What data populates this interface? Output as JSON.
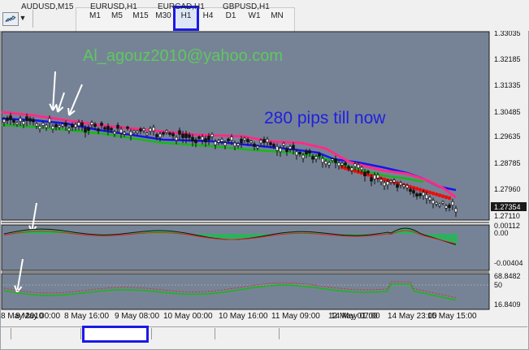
{
  "toolbar": {
    "chart_icon": "chart-line-icon",
    "dropdown_icon": "chevron-down-icon",
    "timeframes": [
      "M1",
      "M5",
      "M15",
      "M30",
      "H1",
      "H4",
      "D1",
      "W1",
      "MN"
    ],
    "active_timeframe": "H1"
  },
  "chart": {
    "watermark_email": "Al_agouz2010@yahoo.com",
    "annotation": "280 pips till now",
    "price_labels": [
      "1.33035",
      "1.32185",
      "1.31335",
      "1.30485",
      "1.29635",
      "1.28785",
      "1.27960",
      "1.27354",
      "1.27110"
    ],
    "current_price": "1.27354",
    "macd_labels": [
      "0.00112",
      "0.00",
      "-0.00404"
    ],
    "rsi_labels": [
      "68.8482",
      "50",
      "16.8409"
    ],
    "date_labels": [
      "8 May 2010",
      "8 May 00:00",
      "8 May 16:00",
      "9 May 08:00",
      "10 May 00:00",
      "10 May 16:00",
      "11 May 09:00",
      "12 May 01:00",
      "14 May 07:00",
      "14 May 23:00",
      "15 May 15:00"
    ]
  },
  "tabs": [
    "AUDUSD,M15",
    "EURUSD,H1",
    "EURCAD,H1",
    "GBPUSD,H1"
  ],
  "active_tab": "EURUSD,H1",
  "colors": {
    "chart_bg": "#768396",
    "pink_line": "#ff2c86",
    "blue_line": "#1515ee",
    "green_line": "#18b818",
    "red_dots": "#e81010",
    "highlight": "#1a1ae6",
    "watermark": "#5ec85e",
    "annotation": "#1f1fe0",
    "histogram": "#2fb060"
  }
}
